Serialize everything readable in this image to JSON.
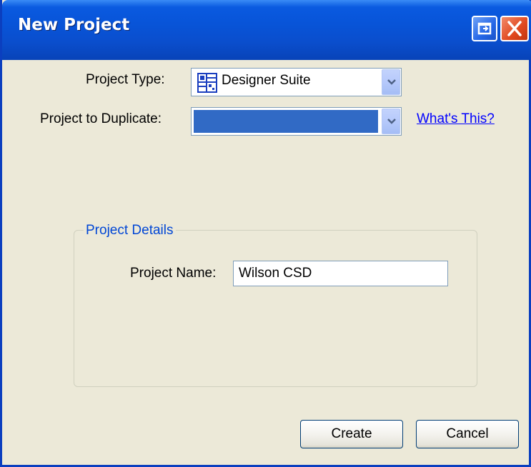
{
  "window": {
    "title": "New Project"
  },
  "form": {
    "project_type_label": "Project Type:",
    "project_type_value": "Designer Suite",
    "project_to_duplicate_label": "Project to Duplicate:",
    "project_to_duplicate_value": "",
    "whats_this_link": "What's This?"
  },
  "project_details": {
    "group_title": "Project Details",
    "project_name_label": "Project Name:",
    "project_name_value": "Wilson CSD"
  },
  "buttons": {
    "create": "Create",
    "cancel": "Cancel"
  },
  "icons": {
    "restore": "restore-icon",
    "close": "close-icon",
    "project_type": "designer-suite-icon",
    "dropdown": "chevron-down-icon"
  },
  "colors": {
    "titlebar": "#0a4ecd",
    "selection": "#316ac5",
    "link": "#0000ff",
    "group_title": "#0046d5"
  }
}
